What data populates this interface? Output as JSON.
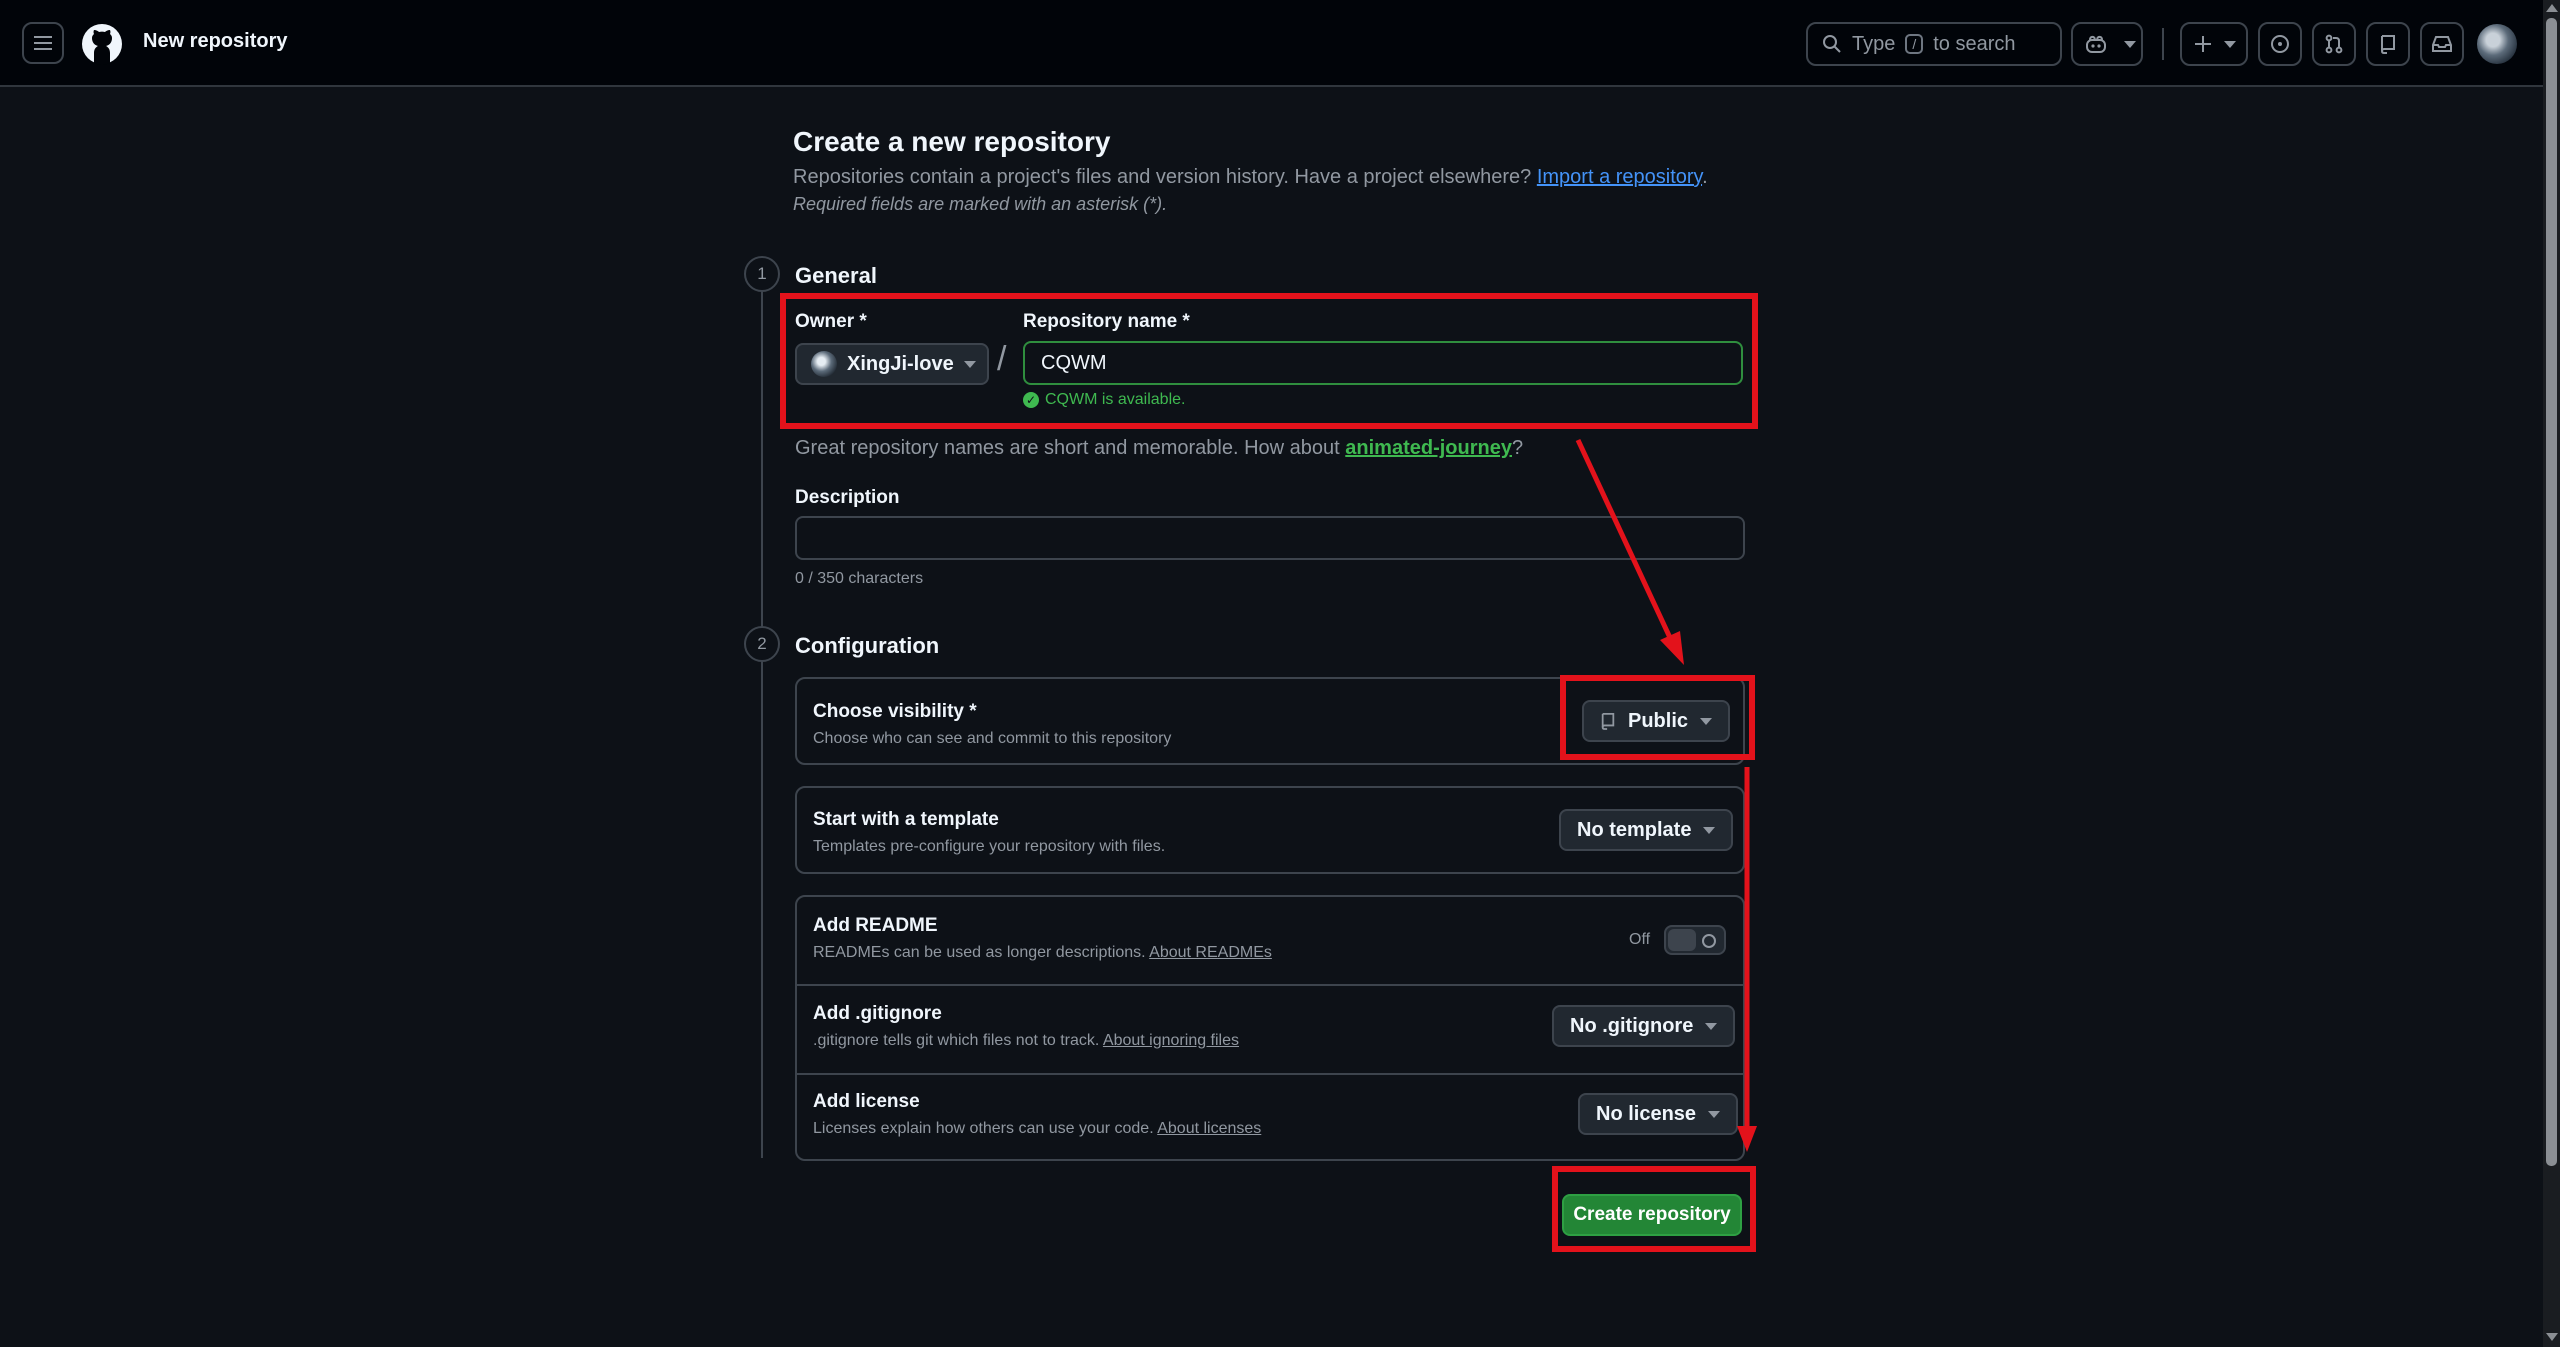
{
  "header": {
    "title": "New repository",
    "search_prefix": "Type",
    "search_key": "/",
    "search_suffix": "to search"
  },
  "page": {
    "heading": "Create a new repository",
    "subtitle": "Repositories contain a project's files and version history. Have a project elsewhere?",
    "import_link": "Import a repository",
    "subtitle_end": ".",
    "required_note": "Required fields are marked with an asterisk (*)."
  },
  "general": {
    "step": "1",
    "title": "General",
    "owner_label": "Owner *",
    "owner_value": "XingJi-love",
    "slash": "/",
    "repo_label": "Repository name *",
    "repo_value": "CQWM",
    "availability": "CQWM is available.",
    "hint_prefix": "Great repository names are short and memorable. How about",
    "hint_suggestion": "animated-journey",
    "hint_suffix": "?",
    "description_label": "Description",
    "description_value": "",
    "counter": "0 / 350 characters"
  },
  "configuration": {
    "step": "2",
    "title": "Configuration",
    "visibility_title": "Choose visibility *",
    "visibility_desc": "Choose who can see and commit to this repository",
    "visibility_value": "Public",
    "template_title": "Start with a template",
    "template_desc": "Templates pre-configure your repository with files.",
    "template_value": "No template",
    "readme_title": "Add README",
    "readme_desc": "READMEs can be used as longer descriptions.",
    "readme_link": "About READMEs",
    "readme_state": "Off",
    "gitignore_title": "Add .gitignore",
    "gitignore_desc": ".gitignore tells git which files not to track.",
    "gitignore_link": "About ignoring files",
    "gitignore_value": "No .gitignore",
    "license_title": "Add license",
    "license_desc": "Licenses explain how others can use your code.",
    "license_link": "About licenses",
    "license_value": "No license"
  },
  "actions": {
    "create_label": "Create repository"
  },
  "colors": {
    "background": "#0d1117",
    "header": "#010409",
    "accent_green": "#238636",
    "link_blue": "#4493f8",
    "annotation_red": "#e3121b"
  },
  "icons": [
    "menu-icon",
    "github-logo-icon",
    "search-icon",
    "copilot-icon",
    "plus-icon",
    "issues-icon",
    "pull-requests-icon",
    "repo-icon",
    "inbox-icon",
    "check-icon"
  ]
}
